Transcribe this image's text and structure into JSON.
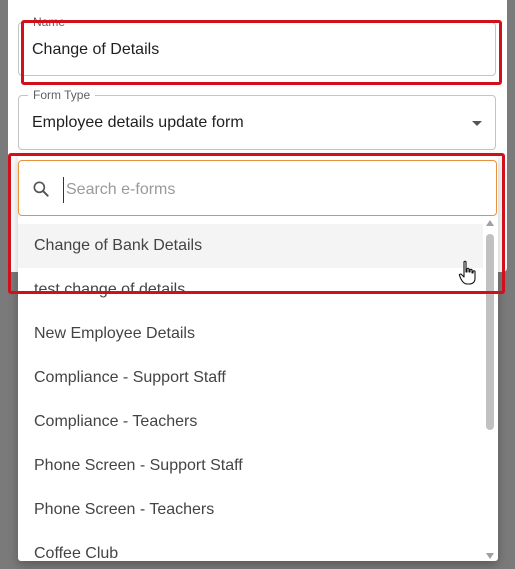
{
  "form": {
    "name": {
      "label": "Name",
      "value": "Change of Details"
    },
    "form_type": {
      "label": "Form Type",
      "value": "Employee details update form"
    }
  },
  "dropdown": {
    "search": {
      "placeholder": "Search e-forms",
      "value": ""
    },
    "items": [
      {
        "label": "Change of Bank Details"
      },
      {
        "label": "test change of details"
      },
      {
        "label": "New Employee Details"
      },
      {
        "label": "Compliance - Support Staff"
      },
      {
        "label": "Compliance - Teachers"
      },
      {
        "label": "Phone Screen - Support Staff"
      },
      {
        "label": "Phone Screen - Teachers"
      },
      {
        "label": "Coffee Club"
      }
    ]
  },
  "colors": {
    "highlight": "#d0101a",
    "focus_border": "#e8913c",
    "overlay": "#7a7a7a"
  },
  "icons": [
    "search-icon",
    "chevron-down-icon",
    "hand-pointer-icon",
    "scroll-up-arrow-icon",
    "scroll-down-arrow-icon"
  ]
}
